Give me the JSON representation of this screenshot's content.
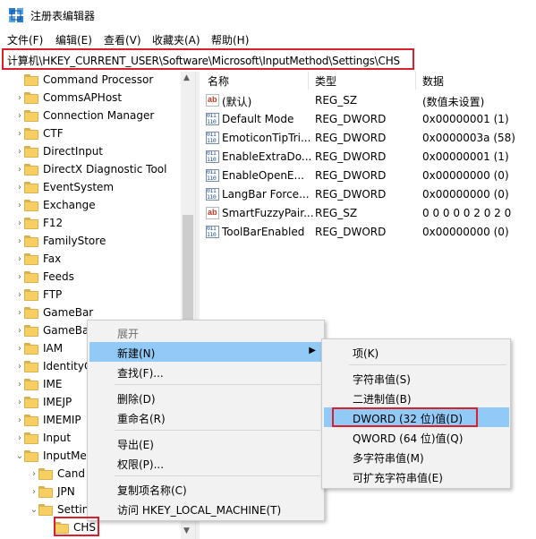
{
  "window": {
    "title": "注册表编辑器",
    "icon": "regedit-icon"
  },
  "menubar": [
    {
      "label": "文件(F)"
    },
    {
      "label": "编辑(E)"
    },
    {
      "label": "查看(V)"
    },
    {
      "label": "收藏夹(A)"
    },
    {
      "label": "帮助(H)"
    }
  ],
  "address": {
    "path": "计算机\\HKEY_CURRENT_USER\\Software\\Microsoft\\InputMethod\\Settings\\CHS"
  },
  "tree": {
    "items": [
      {
        "label": "Command Processor"
      },
      {
        "label": "CommsAPHost"
      },
      {
        "label": "Connection Manager"
      },
      {
        "label": "CTF"
      },
      {
        "label": "DirectInput"
      },
      {
        "label": "DirectX Diagnostic Tool"
      },
      {
        "label": "EventSystem"
      },
      {
        "label": "Exchange"
      },
      {
        "label": "F12"
      },
      {
        "label": "FamilyStore"
      },
      {
        "label": "Fax"
      },
      {
        "label": "Feeds"
      },
      {
        "label": "FTP"
      },
      {
        "label": "GameBar"
      },
      {
        "label": "GameBa"
      },
      {
        "label": "IAM"
      },
      {
        "label": "IdentityC"
      },
      {
        "label": "IME"
      },
      {
        "label": "IMEJP"
      },
      {
        "label": "IMEMIP"
      },
      {
        "label": "Input"
      },
      {
        "label": "InputMe"
      },
      {
        "label": "Cand"
      },
      {
        "label": "JPN"
      },
      {
        "label": "Settin"
      },
      {
        "label": "CHS"
      }
    ]
  },
  "values": {
    "headers": {
      "name": "名称",
      "type": "类型",
      "data": "数据"
    },
    "rows": [
      {
        "icon": "string-value-icon",
        "name": "(默认)",
        "type": "REG_SZ",
        "data": "(数值未设置)"
      },
      {
        "icon": "binary-value-icon",
        "name": "Default Mode",
        "type": "REG_DWORD",
        "data": "0x00000001 (1)"
      },
      {
        "icon": "binary-value-icon",
        "name": "EmoticonTipTri...",
        "type": "REG_DWORD",
        "data": "0x0000003a (58)"
      },
      {
        "icon": "binary-value-icon",
        "name": "EnableExtraDo...",
        "type": "REG_DWORD",
        "data": "0x00000001 (1)"
      },
      {
        "icon": "binary-value-icon",
        "name": "EnableOpenE...",
        "type": "REG_DWORD",
        "data": "0x00000000 (0)"
      },
      {
        "icon": "binary-value-icon",
        "name": "LangBar Force...",
        "type": "REG_DWORD",
        "data": "0x00000000 (0)"
      },
      {
        "icon": "string-value-icon",
        "name": "SmartFuzzyPair...",
        "type": "REG_SZ",
        "data": "0 0 0 0 0 2 0 2 0"
      },
      {
        "icon": "binary-value-icon",
        "name": "ToolBarEnabled",
        "type": "REG_DWORD",
        "data": "0x00000000 (0)"
      }
    ]
  },
  "context_menu": {
    "items": [
      {
        "label": "展开"
      },
      {
        "label": "新建(N)"
      },
      {
        "label": "查找(F)..."
      },
      {
        "label": "删除(D)"
      },
      {
        "label": "重命名(R)"
      },
      {
        "label": "导出(E)"
      },
      {
        "label": "权限(P)..."
      },
      {
        "label": "复制项名称(C)"
      },
      {
        "label": "访问 HKEY_LOCAL_MACHINE(T)"
      }
    ]
  },
  "submenu": {
    "items": [
      {
        "label": "项(K)"
      },
      {
        "label": "字符串值(S)"
      },
      {
        "label": "二进制值(B)"
      },
      {
        "label": "DWORD (32 位)值(D)"
      },
      {
        "label": "QWORD (64 位)值(Q)"
      },
      {
        "label": "多字符串值(M)"
      },
      {
        "label": "可扩充字符串值(E)"
      }
    ]
  },
  "colors": {
    "highlight": "#91c9f7",
    "annotation_red": "#d9202c",
    "folder": "#f6cf62"
  }
}
